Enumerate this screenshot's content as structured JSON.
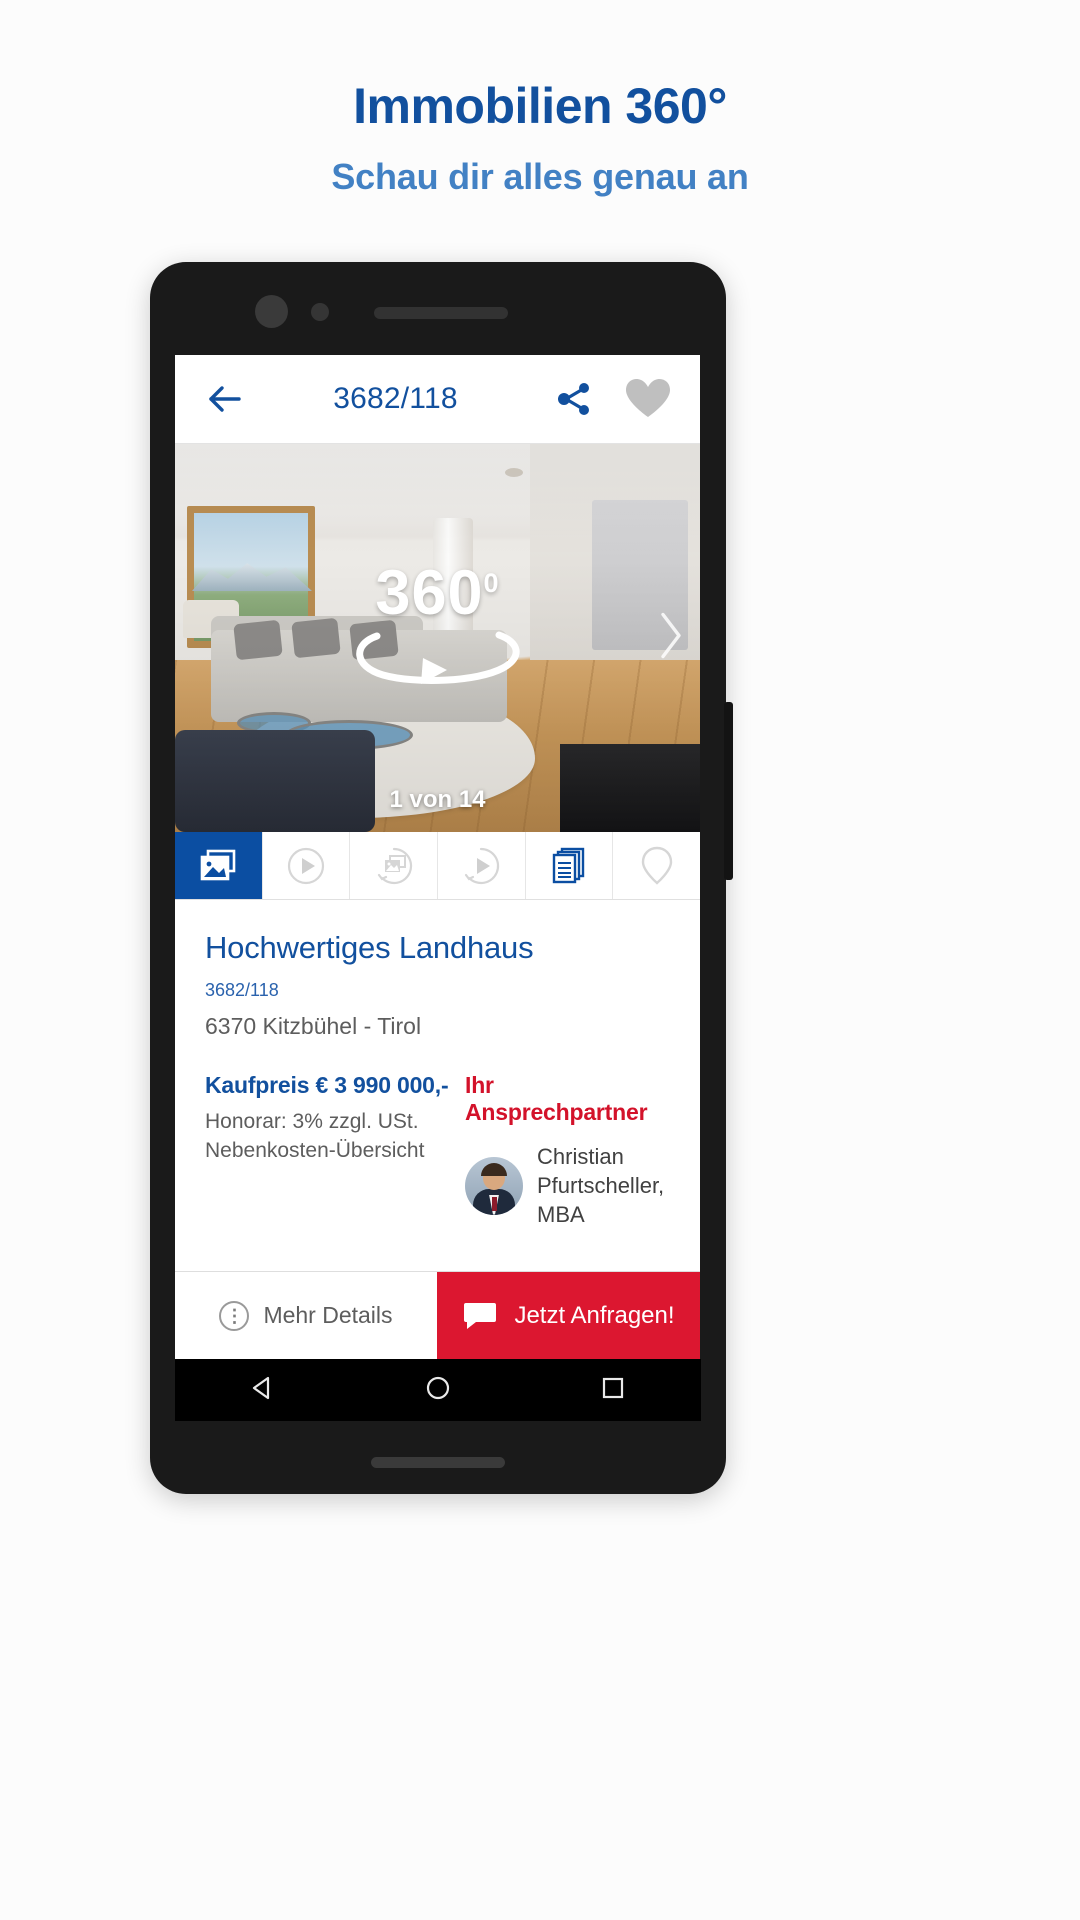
{
  "promo": {
    "headline": "Immobilien 360°",
    "subheadline": "Schau dir alles genau an"
  },
  "app": {
    "appbar": {
      "back_icon": "arrow-left-icon",
      "title": "3682/118",
      "share_icon": "share-icon",
      "favorite_icon": "heart-icon"
    },
    "hero": {
      "badge_number": "360",
      "badge_degree": "0",
      "rotate_icon": "rotate-360-icon",
      "next_icon": "chevron-right-icon",
      "counter": "1 von 14"
    },
    "tabs": [
      {
        "name": "gallery",
        "icon": "photos-icon",
        "active": true
      },
      {
        "name": "video",
        "icon": "play-circle-icon",
        "active": false
      },
      {
        "name": "panorama",
        "icon": "photo-360-icon",
        "active": false
      },
      {
        "name": "video-tour",
        "icon": "play-circle-icon",
        "active": false
      },
      {
        "name": "documents",
        "icon": "documents-icon",
        "active": false
      },
      {
        "name": "map",
        "icon": "location-pin-icon",
        "active": false
      }
    ],
    "listing": {
      "title": "Hochwertiges Landhaus",
      "reference": "3682/118",
      "location": "6370 Kitzbühel - Tirol",
      "price": "Kaufpreis € 3 990 000,-",
      "fee": "Honorar: 3% zzgl. USt.",
      "extra_costs": "Nebenkosten-Übersicht"
    },
    "agent": {
      "heading": "Ihr Ansprechpartner",
      "name_line1": "Christian",
      "name_line2": "Pfurtscheller, MBA",
      "avatar_icon": "avatar"
    },
    "actions": {
      "details_label": "Mehr Details",
      "details_icon": "info-icon",
      "enquire_label": "Jetzt Anfragen!",
      "enquire_icon": "chat-bubble-icon"
    },
    "navbar": {
      "back_icon": "android-back-icon",
      "home_icon": "android-home-icon",
      "recents_icon": "android-recents-icon"
    }
  },
  "colors": {
    "brand_blue": "#12509e",
    "accent_blue": "#4281c4",
    "tab_active": "#0b4ea2",
    "red": "#dc1730",
    "agent_red": "#d3122a"
  }
}
